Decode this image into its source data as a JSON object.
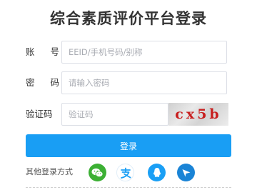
{
  "page": {
    "title": "综合素质评价平台登录"
  },
  "form": {
    "account": {
      "label": "账 号",
      "placeholder": "EEID/手机号码/别称",
      "value": ""
    },
    "password": {
      "label": "密 码",
      "placeholder": "请输入密码",
      "value": ""
    },
    "captcha": {
      "label": "验证码",
      "placeholder": "验证码",
      "value": "",
      "image_text": "cx5b"
    },
    "submit_label": "登录"
  },
  "other_login": {
    "label": "其他登录方式",
    "providers": [
      {
        "name": "wechat",
        "icon": "wechat-icon",
        "color": "#3cb034"
      },
      {
        "name": "alipay",
        "icon": "alipay-icon",
        "color": "#1a9ff5"
      },
      {
        "name": "qq",
        "icon": "qq-icon",
        "color": "#1a9ff5"
      },
      {
        "name": "other",
        "icon": "paper-plane-icon",
        "color": "#1a84d6"
      }
    ]
  },
  "colors": {
    "primary": "#199ef4",
    "wechat": "#3cb034",
    "captcha_text": "#c81e1e"
  }
}
